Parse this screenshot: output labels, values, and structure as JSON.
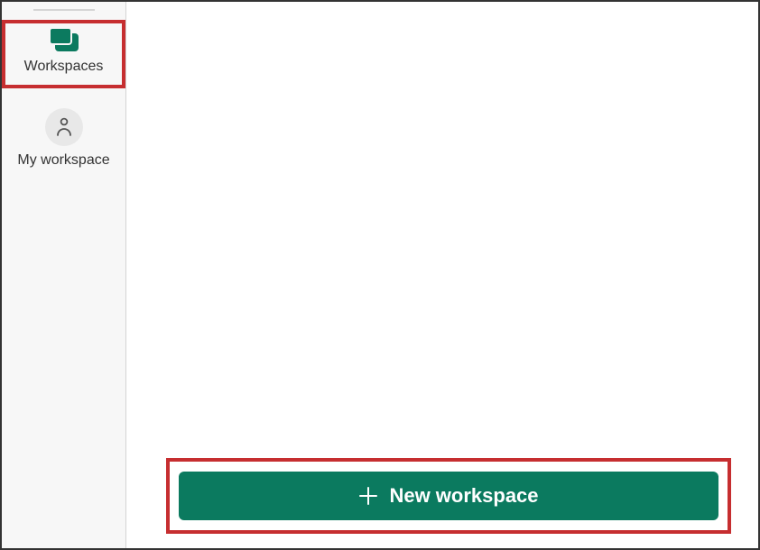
{
  "sidebar": {
    "items": [
      {
        "label": "Workspaces",
        "icon": "workspaces-icon",
        "highlighted": true
      },
      {
        "label": "My workspace",
        "icon": "person-icon",
        "highlighted": false
      }
    ]
  },
  "main": {
    "new_workspace_button": {
      "label": "New workspace",
      "icon": "plus-icon"
    }
  },
  "colors": {
    "accent": "#0b7a5f",
    "highlight_border": "#c62e30",
    "sidebar_bg": "#f7f7f7"
  }
}
